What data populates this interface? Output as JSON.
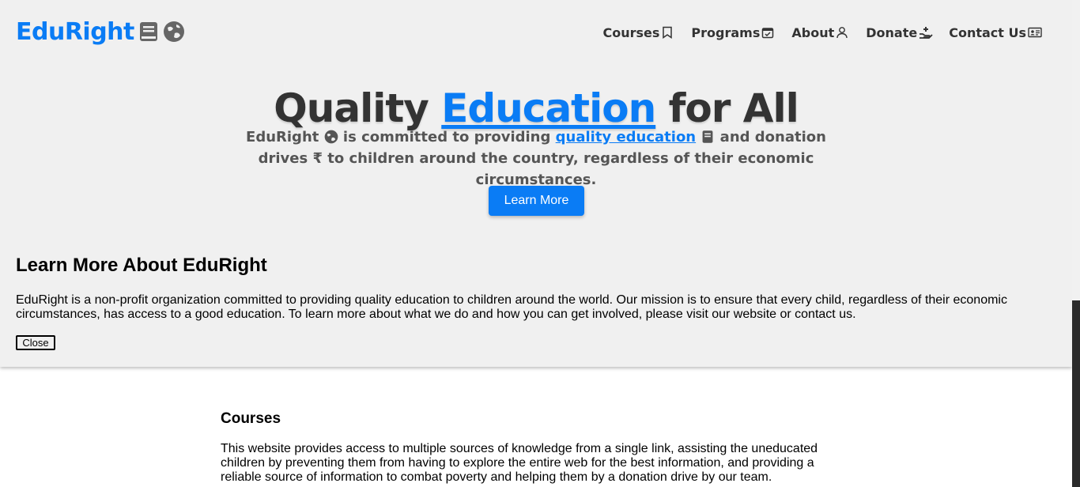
{
  "brand": {
    "name": "EduRight",
    "accent_color": "#0a7cf5",
    "icons": [
      "book-icon",
      "globe-icon"
    ]
  },
  "nav": {
    "items": [
      {
        "label": "Courses",
        "icon": "bookmark-icon"
      },
      {
        "label": "Programs",
        "icon": "calendar-check-icon"
      },
      {
        "label": "About",
        "icon": "user-icon"
      },
      {
        "label": "Donate",
        "icon": "hand-donate-icon"
      },
      {
        "label": "Contact Us",
        "icon": "id-card-icon"
      }
    ]
  },
  "hero": {
    "headline_pre": "Quality ",
    "headline_accent": "Education",
    "headline_post": " for All",
    "subtitle": {
      "part1": "EduRight",
      "part2": " is committed to providing ",
      "link": "quality education",
      "part3": " and donation drives ",
      "part4": " to children around the country, regardless of their economic circumstances."
    },
    "cta_label": "Learn More"
  },
  "about_panel": {
    "title": "Learn More About EduRight",
    "body": "EduRight is a non-profit organization committed to providing quality education to children around the world. Our mission is to ensure that every child, regardless of their economic circumstances, has access to a good education. To learn more about what we do and how you can get involved, please visit our website or contact us.",
    "close_label": "Close"
  },
  "courses": {
    "title": "Courses",
    "body": "This website provides access to multiple sources of knowledge from a single link, assisting the uneducated children by preventing them from having to explore the entire web for the best information, and providing a reliable source of information to combat poverty and helping them by a donation drive by our team."
  }
}
